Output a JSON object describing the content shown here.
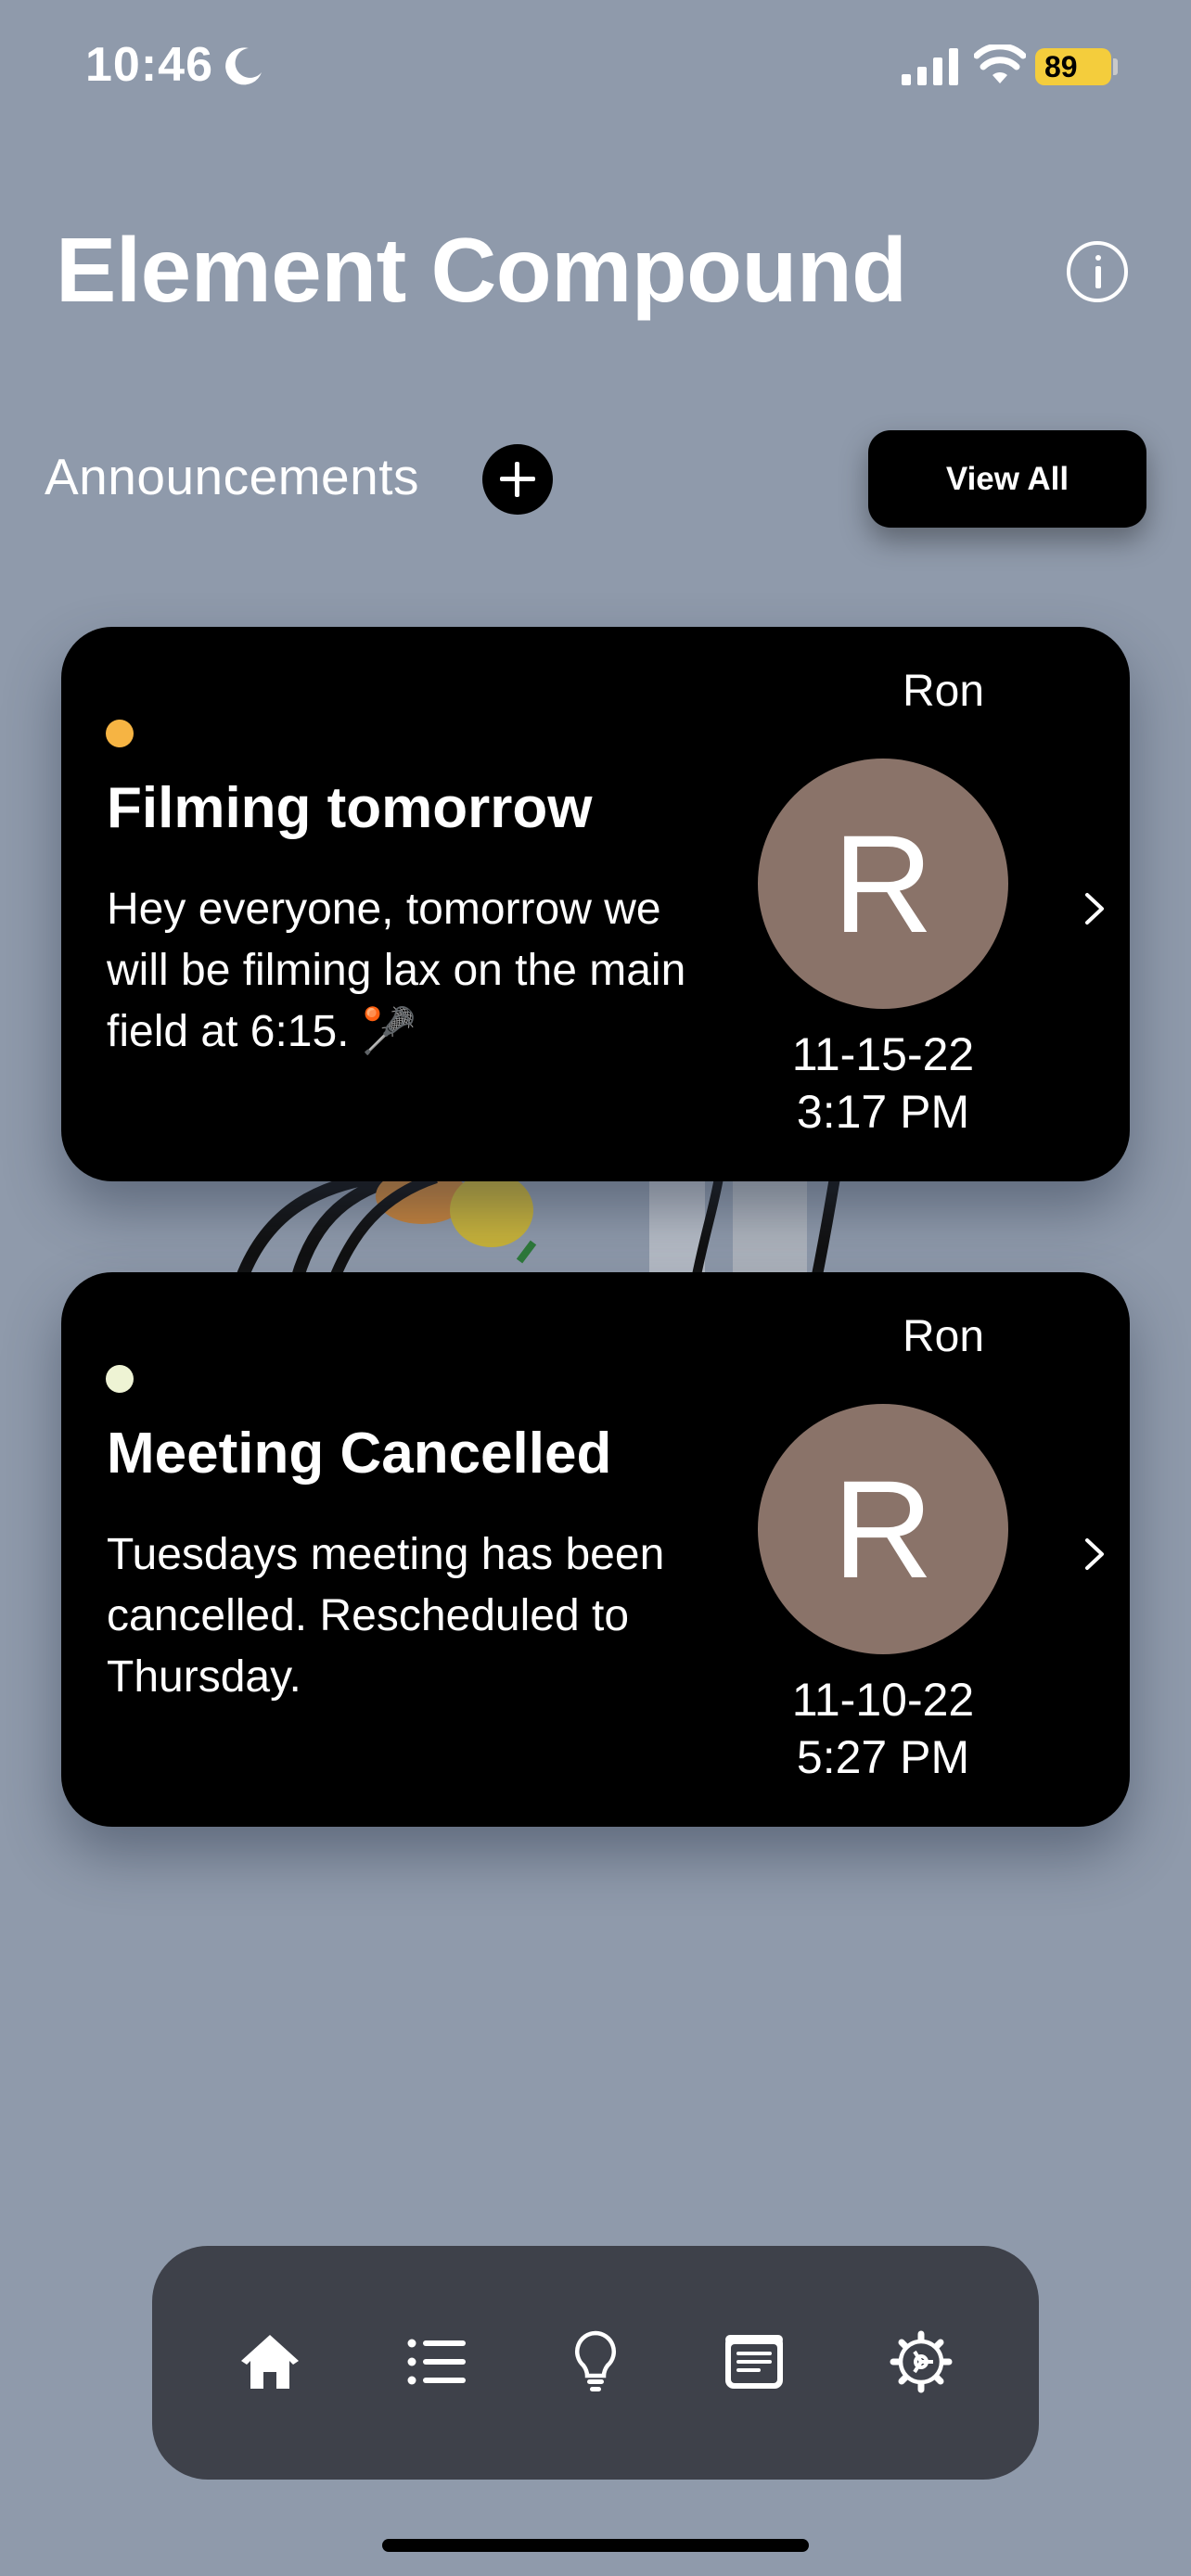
{
  "status_bar": {
    "time": "10:46",
    "battery": "89"
  },
  "header": {
    "title": "Element Compound"
  },
  "announcements": {
    "label": "Announcements",
    "view_all_label": "View All",
    "items": [
      {
        "status_color": "#f6b443",
        "title": "Filming tomorrow",
        "body": "Hey everyone, tomorrow we will be filming lax on the main field at 6:15. 🥍",
        "author": "Ron",
        "avatar_initial": "R",
        "date": "11-15-22",
        "time": "3:17 PM"
      },
      {
        "status_color": "#eef3d4",
        "title": "Meeting Cancelled",
        "body": "Tuesdays meeting has been cancelled. Rescheduled to Thursday.",
        "author": "Ron",
        "avatar_initial": "R",
        "date": "11-10-22",
        "time": "5:27 PM"
      }
    ]
  },
  "tab_bar": {
    "tabs": [
      {
        "icon": "home-icon"
      },
      {
        "icon": "list-icon"
      },
      {
        "icon": "lightbulb-icon"
      },
      {
        "icon": "document-icon"
      },
      {
        "icon": "settings-icon"
      }
    ]
  },
  "colors": {
    "background": "#8f9aab",
    "card": "#000000",
    "tab_bar": "#3e414a",
    "avatar": "#8a7369",
    "battery": "#f4cd3c"
  }
}
